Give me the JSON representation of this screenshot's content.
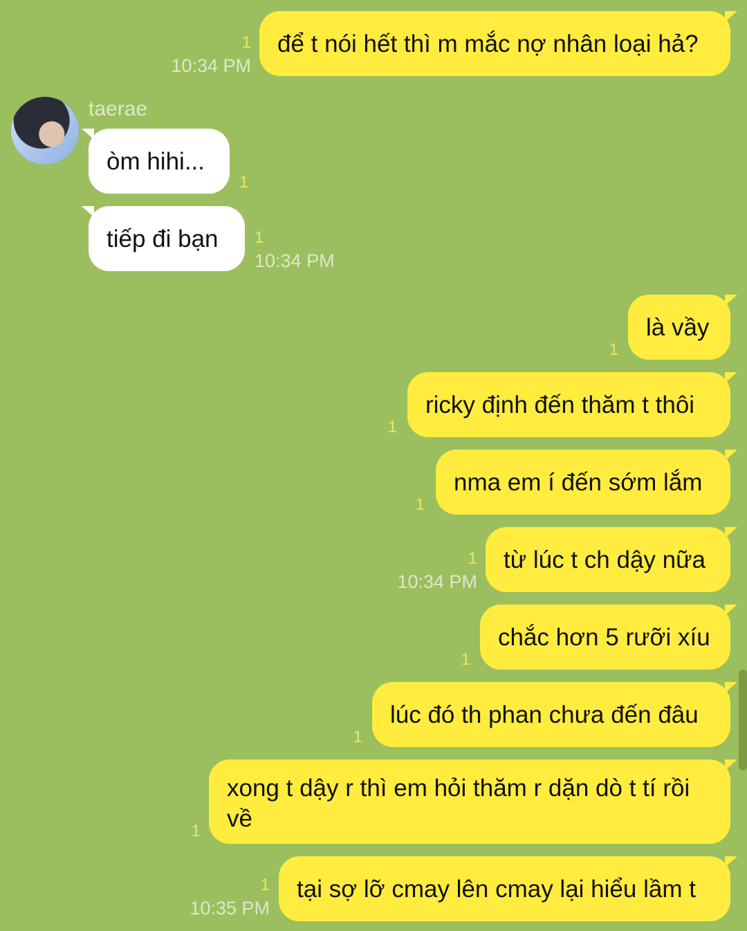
{
  "messages": [
    {
      "id": "m1",
      "direction": "out",
      "text": "để t nói hết thì m mắc nợ nhân loại hả?",
      "read": "1",
      "time": "10:34 PM"
    },
    {
      "id": "m2",
      "direction": "in",
      "sender": "taerae",
      "text": "òm hihi...",
      "read": "1"
    },
    {
      "id": "m3",
      "direction": "in",
      "text": "tiếp đi bạn",
      "read": "1",
      "time": "10:34 PM"
    },
    {
      "id": "m4",
      "direction": "out",
      "text": "là vầy",
      "read": "1"
    },
    {
      "id": "m5",
      "direction": "out",
      "text": "ricky định đến thăm t thôi",
      "read": "1"
    },
    {
      "id": "m6",
      "direction": "out",
      "text": "nma em í đến sớm lắm",
      "read": "1"
    },
    {
      "id": "m7",
      "direction": "out",
      "text": "từ lúc t ch dậy nữa",
      "read": "1",
      "time": "10:34 PM"
    },
    {
      "id": "m8",
      "direction": "out",
      "text": "chắc hơn 5 rưỡi xíu",
      "read": "1"
    },
    {
      "id": "m9",
      "direction": "out",
      "text": "lúc đó th phan chưa đến đâu",
      "read": "1"
    },
    {
      "id": "m10",
      "direction": "out",
      "text": "xong t dậy r thì em hỏi thăm r dặn dò t tí rồi về",
      "read": "1"
    },
    {
      "id": "m11",
      "direction": "out",
      "text": "tại sợ lỡ cmay lên cmay lại hiểu lầm t",
      "read": "1",
      "time": "10:35 PM"
    }
  ],
  "colors": {
    "background": "#9bbf5f",
    "outgoing_bubble": "#ffec3f",
    "incoming_bubble": "#ffffff",
    "read_count": "#f0e65c",
    "meta_text": "#dfe7c9"
  }
}
